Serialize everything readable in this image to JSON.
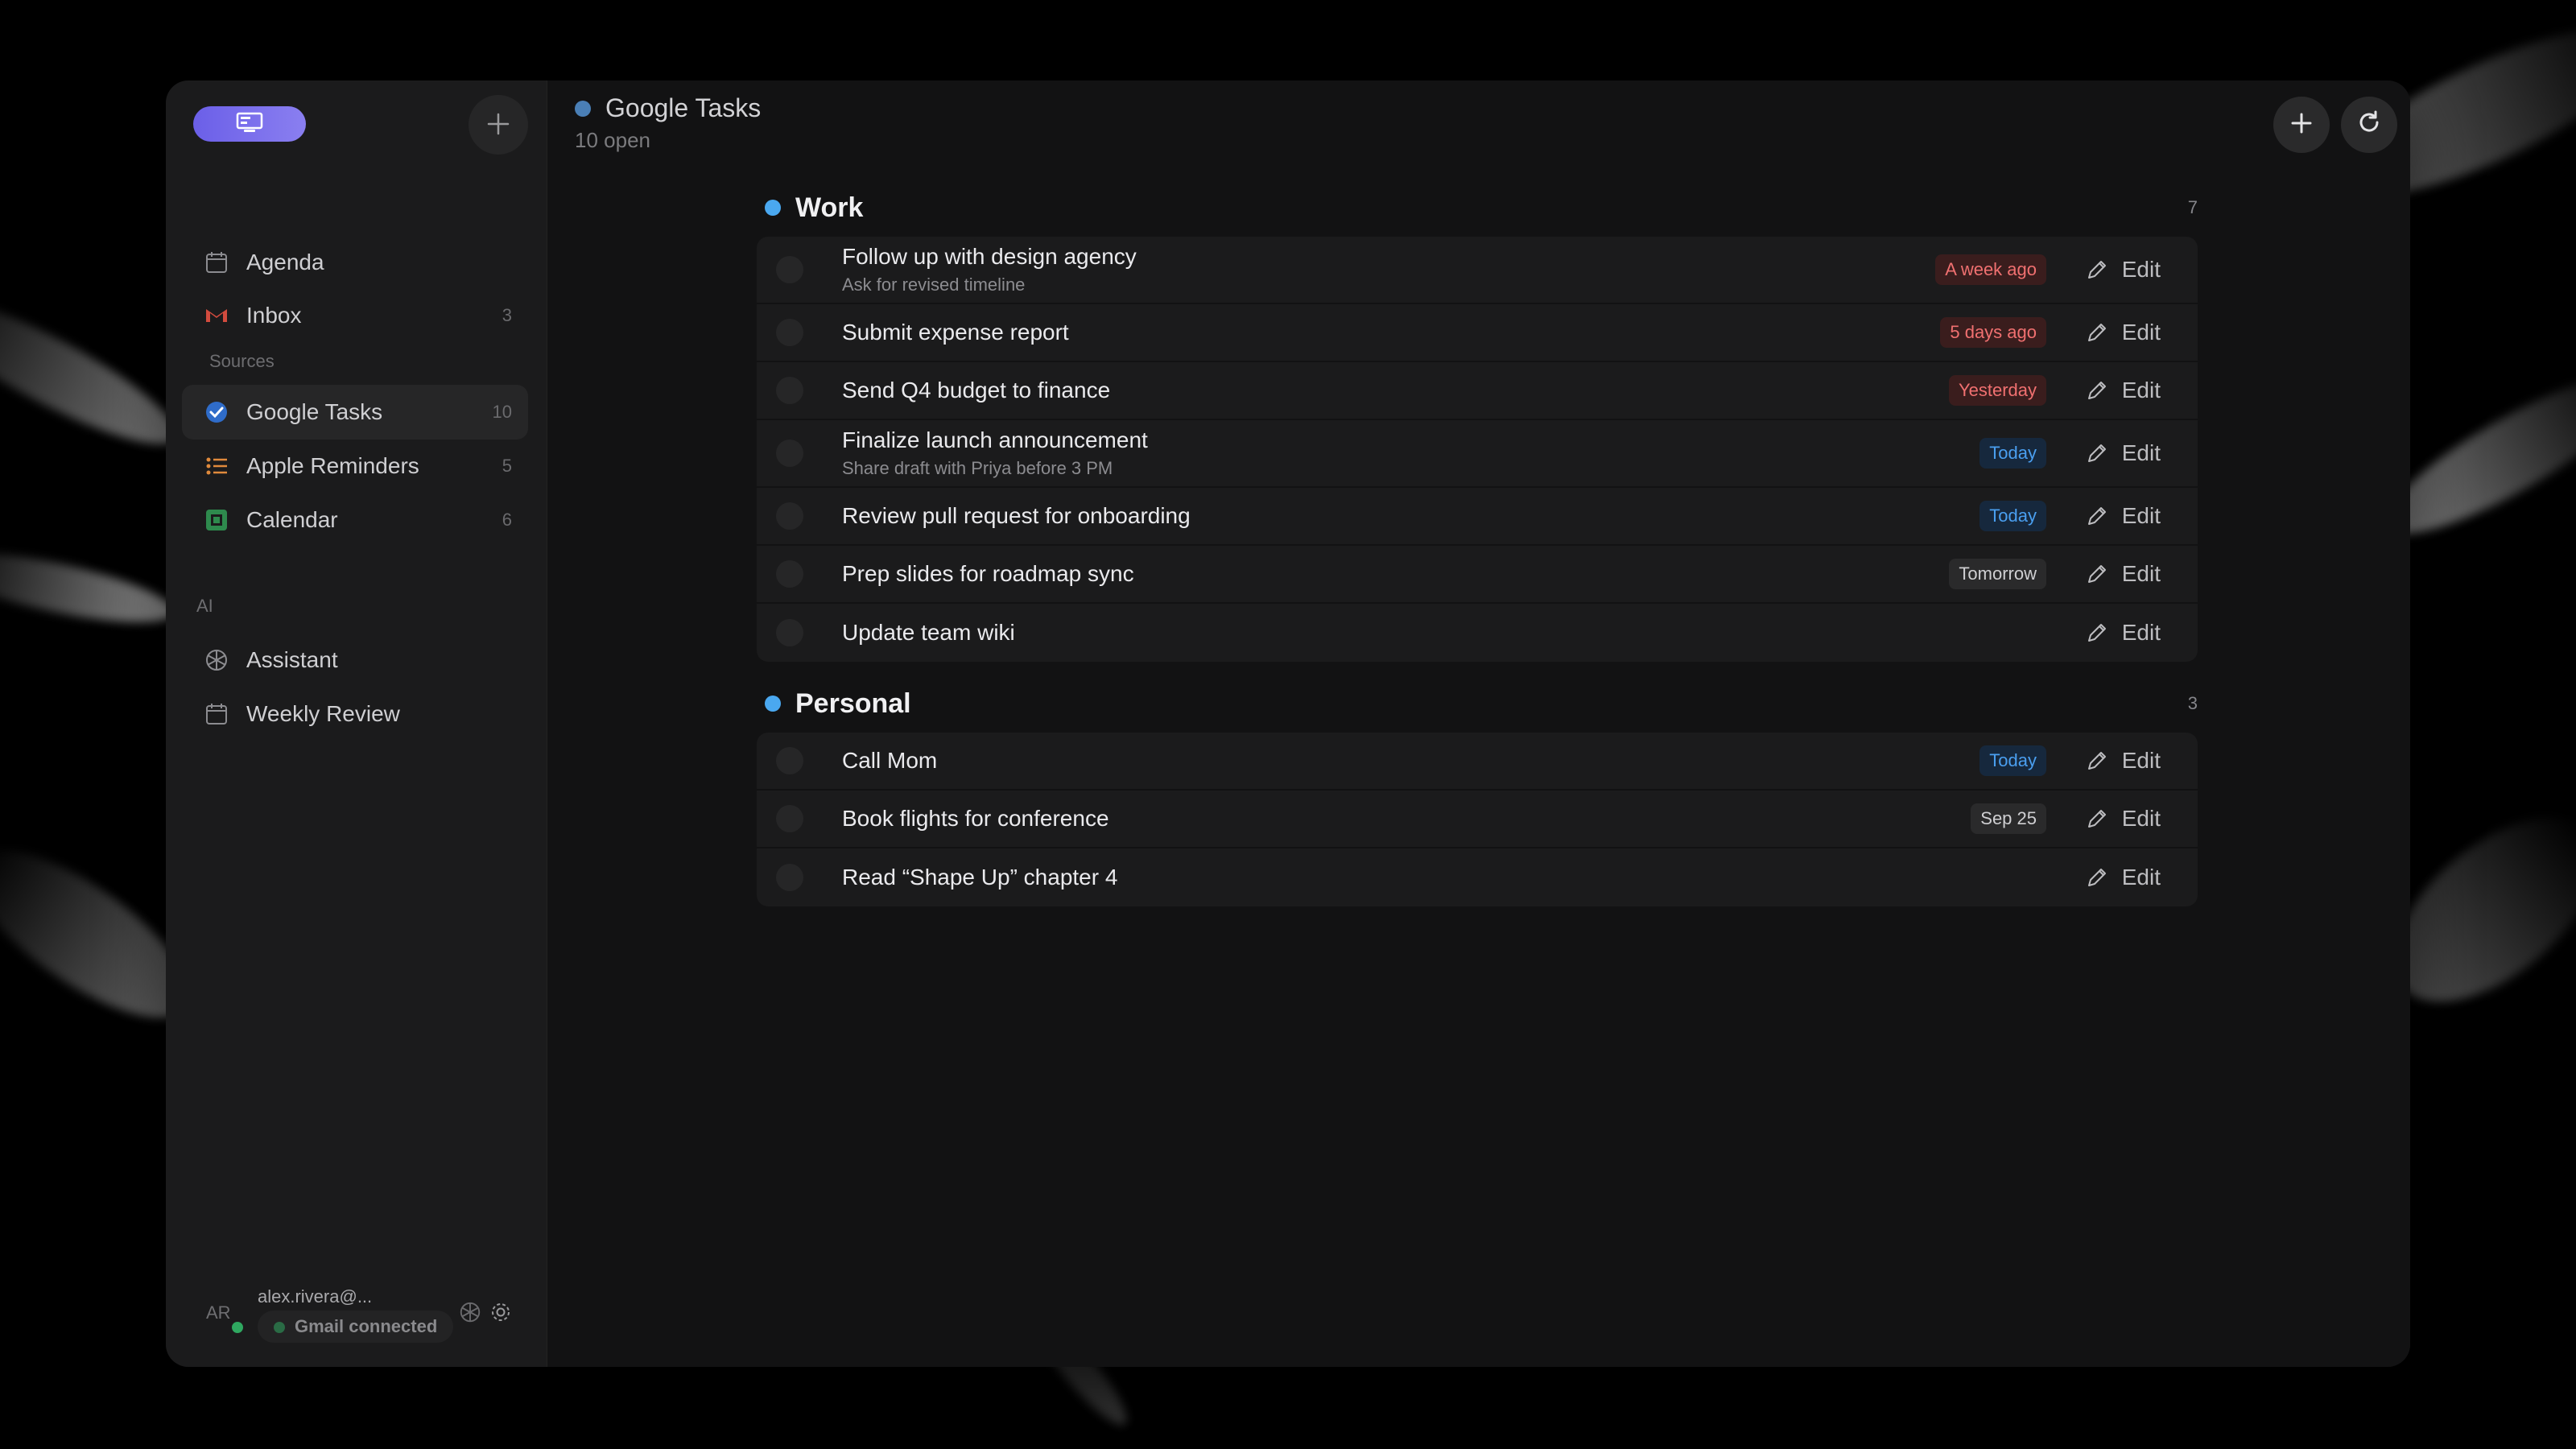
{
  "app": {
    "brand_icon": "app-logo-icon",
    "new_button_icon": "plus-icon"
  },
  "sidebar": {
    "nav": [
      {
        "label": "Agenda",
        "icon": "calendar-icon",
        "count": ""
      },
      {
        "label": "Inbox",
        "icon": "gmail-icon",
        "count": "3"
      }
    ],
    "sources_label": "Sources",
    "sources": [
      {
        "label": "Google Tasks",
        "icon": "google-tasks-icon",
        "count": "10",
        "active": true
      },
      {
        "label": "Apple Reminders",
        "icon": "list-icon",
        "count": "5"
      },
      {
        "label": "Calendar",
        "icon": "google-calendar-icon",
        "count": "6"
      }
    ],
    "ai_label": "AI",
    "ai_items": [
      {
        "label": "Assistant",
        "icon": "openai-icon"
      },
      {
        "label": "Weekly Review",
        "icon": "calendar-icon"
      }
    ],
    "profile": {
      "initials": "AR",
      "email": "alex.rivera@...",
      "status": "Gmail connected"
    }
  },
  "main": {
    "title": "Google Tasks",
    "subtitle": "10 open",
    "edit_label": "Edit",
    "groups": [
      {
        "name": "Work",
        "count": "7",
        "tasks": [
          {
            "title": "Follow up with design agency",
            "note": "Ask for revised timeline",
            "badge": "A week ago",
            "badge_type": "overdue"
          },
          {
            "title": "Submit expense report",
            "note": "",
            "badge": "5 days ago",
            "badge_type": "overdue"
          },
          {
            "title": "Send Q4 budget to finance",
            "note": "",
            "badge": "Yesterday",
            "badge_type": "overdue"
          },
          {
            "title": "Finalize launch announcement",
            "note": "Share draft with Priya before 3 PM",
            "badge": "Today",
            "badge_type": "today"
          },
          {
            "title": "Review pull request for onboarding",
            "note": "",
            "badge": "Today",
            "badge_type": "today"
          },
          {
            "title": "Prep slides for roadmap sync",
            "note": "",
            "badge": "Tomorrow",
            "badge_type": "neutral"
          },
          {
            "title": "Update team wiki",
            "note": "",
            "badge": "",
            "badge_type": ""
          }
        ]
      },
      {
        "name": "Personal",
        "count": "3",
        "tasks": [
          {
            "title": "Call Mom",
            "note": "",
            "badge": "Today",
            "badge_type": "today"
          },
          {
            "title": "Book flights for conference",
            "note": "",
            "badge": "Sep 25",
            "badge_type": "neutral"
          },
          {
            "title": "Read “Shape Up” chapter 4",
            "note": "",
            "badge": "",
            "badge_type": ""
          }
        ]
      }
    ]
  },
  "colors": {
    "accent": "#6b5fe8",
    "overdue": "#f07070",
    "today": "#4a9ff0",
    "group_dot": "#4aa8f0"
  }
}
